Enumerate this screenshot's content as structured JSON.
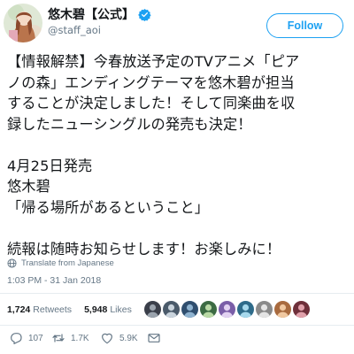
{
  "user": {
    "display_name": "悠木碧【公式】",
    "handle": "@staff_aoi",
    "verified": true,
    "avatar_icon": "anime-character-avatar"
  },
  "follow_button": {
    "label": "Follow"
  },
  "tweet": {
    "lines": [
      "【情報解禁】今春放送予定のTVアニメ「ピア",
      "ノの森」エンディングテーマを悠木碧が担当",
      "することが決定しました！そして同楽曲を収",
      "録したニューシングルの発売も決定！",
      "",
      "4月25日発売",
      "悠木碧",
      "「帰る場所があるということ」",
      "",
      "続報は随時お知らせします！お楽しみに！"
    ]
  },
  "translate": {
    "label": "Translate from Japanese",
    "icon": "globe-icon"
  },
  "timestamp": "1:03 PM - 31 Jan 2018",
  "stats": {
    "retweets_count": "1,724",
    "retweets_label": "Retweets",
    "likes_count": "5,948",
    "likes_label": "Likes",
    "liker_count": 9
  },
  "actions": {
    "reply_count": "107",
    "retweet_count": "1.7K",
    "like_count": "5.9K"
  },
  "colors": {
    "accent": "#1da1f2",
    "text": "#14171a",
    "secondary_text": "#657786",
    "divider": "#e6ecf0",
    "verified": "#1da1f2"
  }
}
